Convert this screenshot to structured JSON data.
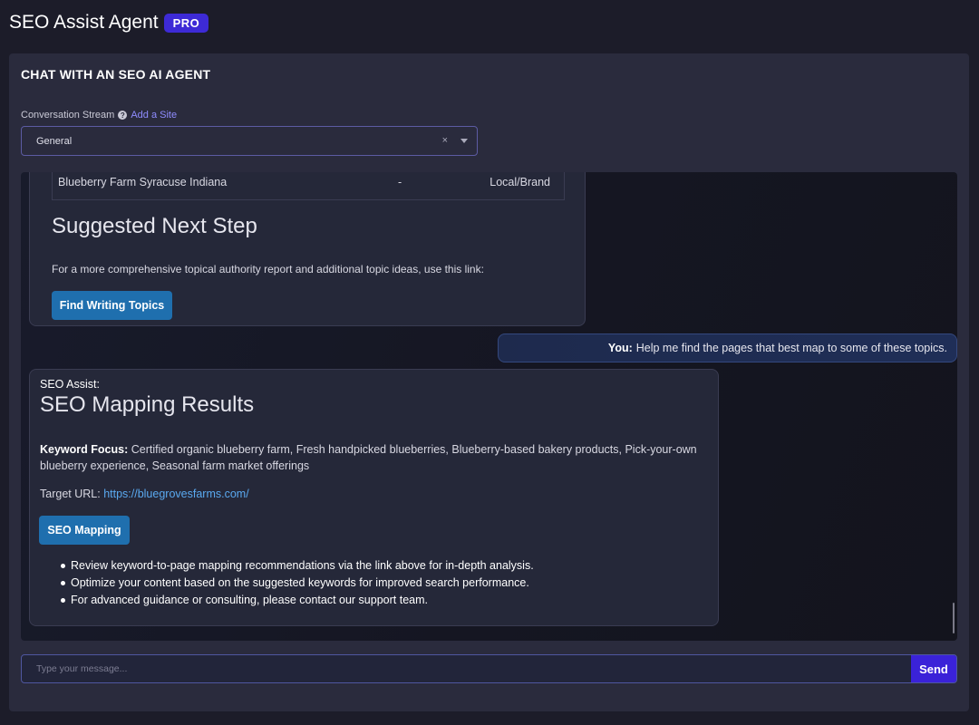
{
  "header": {
    "title": "SEO Assist Agent",
    "badge": "PRO"
  },
  "panel": {
    "title": "CHAT WITH AN SEO AI AGENT",
    "stream_label": "Conversation Stream",
    "help_icon": "?",
    "add_site_label": "Add a Site",
    "stream_value": "General",
    "clear_glyph": "×"
  },
  "prev_card": {
    "table_row": {
      "keyword": "Blueberry Farm Syracuse Indiana",
      "volume": "-",
      "type": "Local/Brand"
    },
    "heading": "Suggested Next Step",
    "paragraph": "For a more comprehensive topical authority report and additional topic ideas, use this link:",
    "button_label": "Find Writing Topics"
  },
  "user_message": {
    "sender": "You:",
    "text": "Help me find the pages that best map to some of these topics."
  },
  "result_card": {
    "agent_label": "SEO Assist:",
    "heading": "SEO Mapping Results",
    "keyword_focus_label": "Keyword Focus:",
    "keyword_focus_text": "Certified organic blueberry farm, Fresh handpicked blueberries, Blueberry-based bakery products, Pick-your-own blueberry experience, Seasonal farm market offerings",
    "target_url_label": "Target URL:",
    "target_url": "https://bluegrovesfarms.com/",
    "button_label": "SEO Mapping",
    "bullets": [
      "Review keyword-to-page mapping recommendations via the link above for in-depth analysis.",
      "Optimize your content based on the suggested keywords for improved search performance.",
      "For advanced guidance or consulting, please contact our support team."
    ]
  },
  "composer": {
    "placeholder": "Type your message...",
    "send_label": "Send"
  }
}
